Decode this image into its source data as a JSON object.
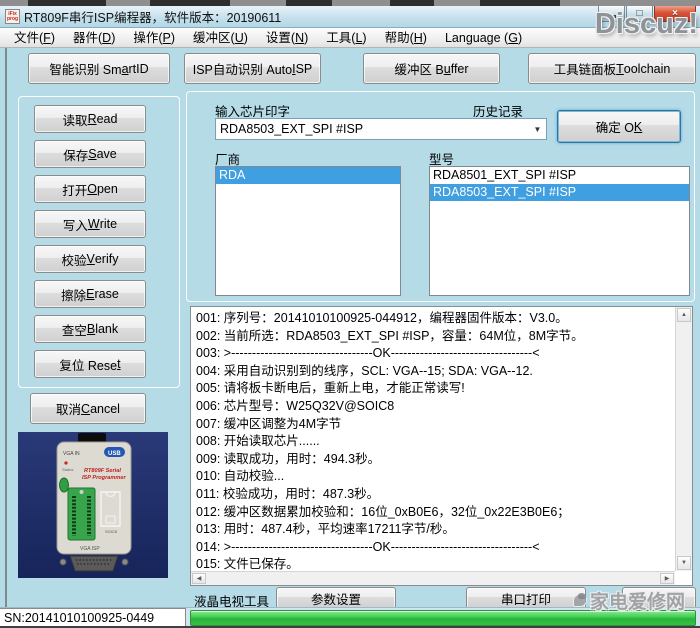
{
  "background": {
    "discuz_watermark": "Discuz!",
    "repair_watermark": "家电爱修网"
  },
  "window": {
    "title": "RT809F串行ISP编程器，软件版本：20190611",
    "app_icon_text": "iFix prog",
    "controls": {
      "maximize_icon": "□",
      "close_icon": "×"
    }
  },
  "menu": {
    "items": [
      "文件([F])",
      "器件([D])",
      "操作([P])",
      "缓冲区([U])",
      "设置([N])",
      "工具([L])",
      "帮助([H])",
      "Language ([G])"
    ]
  },
  "toolbar": {
    "buttons": [
      "智能识别 Sm[a]rtID",
      "ISP自动识别 Auto[I]SP",
      "缓冲区 B[u]ffer",
      "工具链面板 [T]oolchain"
    ]
  },
  "left_panel": {
    "action_buttons": [
      "读取 [R]ead",
      "保存 [S]ave",
      "打开 [O]pen",
      "写入 [W]rite",
      "校验 [V]erify",
      "擦除 [E]rase",
      "查空 [B]lank",
      "复位 Rese[t]"
    ],
    "cancel_label": "取消 [C]ancel",
    "device_photo": {
      "vga_in": "VGA IN",
      "usb": "USB",
      "status": "Status",
      "name_line1": "RT809F Serial",
      "name_line2": "ISP Programmer",
      "vga_isp": "VGA ISP"
    }
  },
  "chip_select": {
    "input_label": "输入芯片印字",
    "history_label": "历史记录",
    "input_value": "RDA8503_EXT_SPI #ISP",
    "dropdown_icon": "▼",
    "ok_label": "确定 O[K]",
    "vendor_label": "厂商",
    "model_label": "型号",
    "vendors": [
      {
        "name": "RDA",
        "selected": true
      }
    ],
    "models": [
      {
        "name": "RDA8501_EXT_SPI #ISP",
        "selected": false
      },
      {
        "name": "RDA8503_EXT_SPI #ISP",
        "selected": true
      }
    ]
  },
  "log": {
    "lines": [
      "001: 序列号：20141010100925-044912，编程器固件版本：V3.0。",
      "002: 当前所选：RDA8503_EXT_SPI #ISP，容量：64M位，8M字节。",
      "003: >----------------------------------OK----------------------------------<",
      "004: 采用自动识别到的线序，SCL: VGA--15; SDA: VGA--12.",
      "005: 请将板卡断电后，重新上电，才能正常读写!",
      "006: 芯片型号：W25Q32V@SOIC8",
      "007: 缓冲区调整为4M字节",
      "008: 开始读取芯片......",
      "009: 读取成功，用时：494.3秒。",
      "010: 自动校验...",
      "011: 校验成功，用时：487.3秒。",
      "012: 缓冲区数据累加校验和：16位_0xB0E6，32位_0x22E3B0E6；",
      "013: 用时：487.4秒，平均速率17211字节/秒。",
      "014: >----------------------------------OK----------------------------------<",
      "015: 文件已保存。"
    ],
    "scroll_icons": {
      "up": "▲",
      "down": "▼",
      "left": "◀",
      "right": "▶"
    }
  },
  "bottom": {
    "lcd_tools_label": "液晶电视工具",
    "param_button": "参数设置",
    "serial_print_button": "串口打印"
  },
  "status": {
    "serial": "SN:20141010100925-0449",
    "progress_percent": 100
  },
  "colors": {
    "desktop_bg": "#b5dbe7",
    "selection_blue": "#3f9fe0",
    "progress_green": "#3ecb4e",
    "close_red": "#c03c23"
  }
}
